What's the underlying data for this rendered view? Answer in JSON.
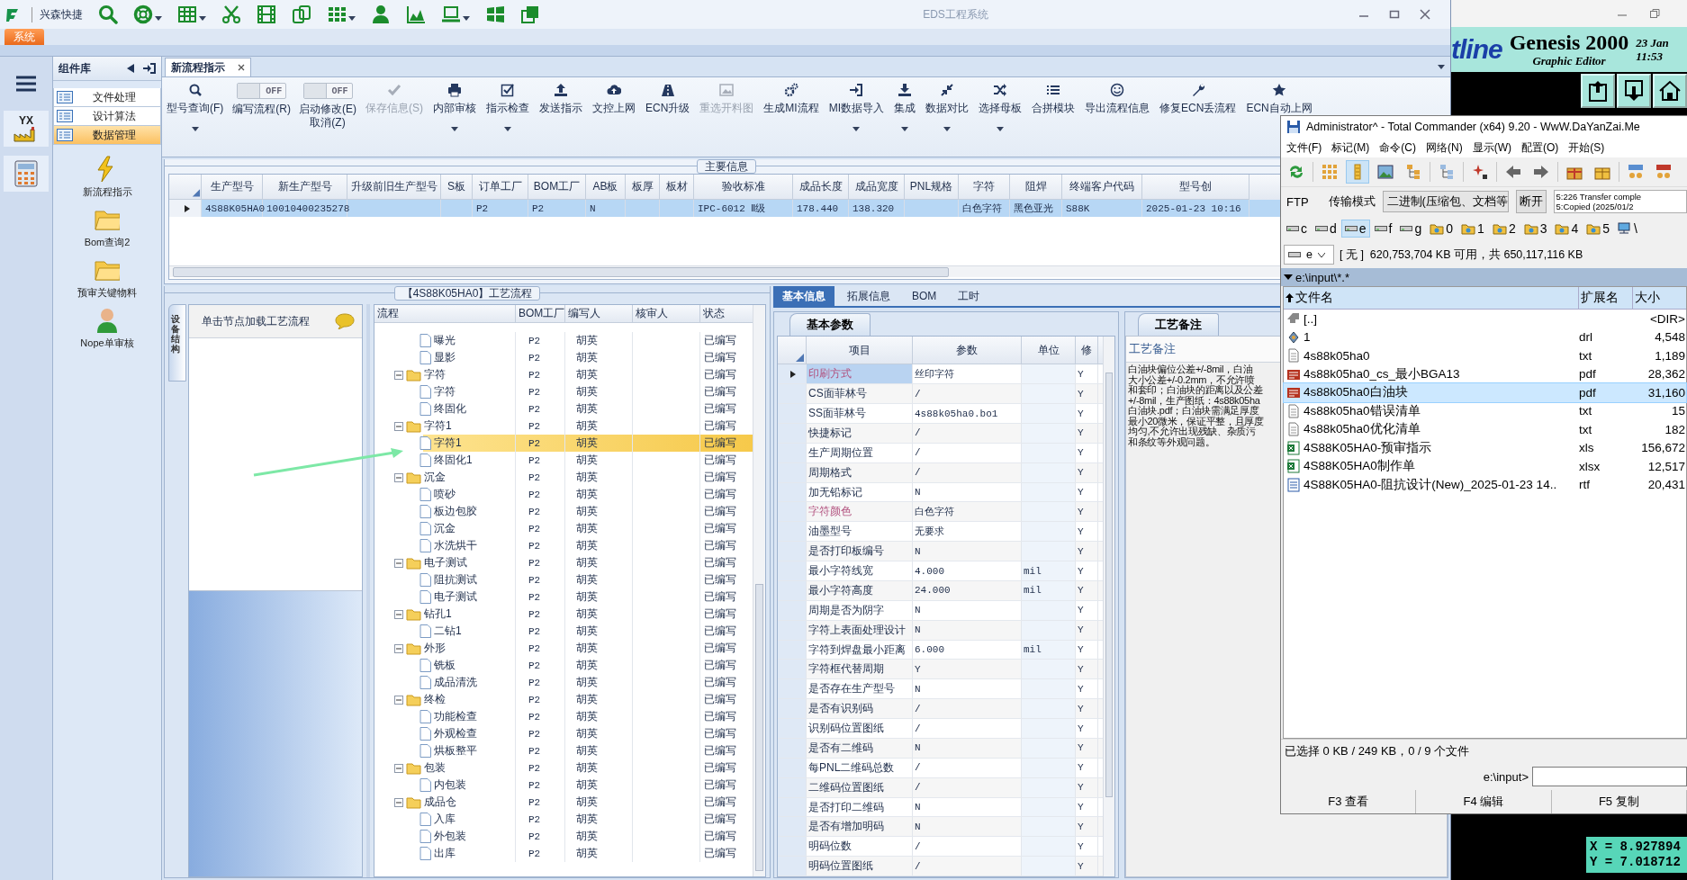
{
  "window": {
    "title": "EDS工程系统"
  },
  "quick_bar": {
    "app_name": "兴森快捷",
    "tools": [
      {
        "dropdown": false
      },
      {
        "dropdown": true
      },
      {
        "dropdown": true
      },
      {
        "dropdown": false
      },
      {
        "dropdown": false
      },
      {
        "dropdown": false
      },
      {
        "dropdown": true
      },
      {
        "dropdown": false
      },
      {
        "dropdown": false
      },
      {
        "dropdown": true
      },
      {
        "dropdown": false
      },
      {
        "dropdown": false
      }
    ]
  },
  "ribbon_tabs": [
    {
      "label": "系统",
      "selected": true
    }
  ],
  "left_rail": {
    "badge": "YX"
  },
  "component_library": {
    "title": "组件库",
    "sections": [
      {
        "label": "文件处理",
        "selected": false
      },
      {
        "label": "设计算法",
        "selected": false
      },
      {
        "label": "数据管理",
        "selected": true
      }
    ],
    "tools": [
      {
        "label": "新流程指示"
      },
      {
        "label": "Bom查询2"
      },
      {
        "label": "预审关键物料"
      },
      {
        "label": "Nope单审核"
      }
    ]
  },
  "document_tabs": [
    {
      "label": "新流程指示",
      "selected": true
    }
  ],
  "toolbar": [
    {
      "kind": "button",
      "label": "型号查询(F)",
      "dropdown": true,
      "disabled": false
    },
    {
      "kind": "toggle",
      "label": "编写流程(R)",
      "state_text": "OFF",
      "on": false
    },
    {
      "kind": "toggle",
      "label": "启动修改(E)\n取消(Z)",
      "state_text": "OFF",
      "on": false
    },
    {
      "kind": "button",
      "label": "保存信息(S)",
      "dropdown": false,
      "disabled": true
    },
    {
      "kind": "button",
      "label": "内部审核",
      "dropdown": true,
      "disabled": false
    },
    {
      "kind": "button",
      "label": "指示检查",
      "dropdown": true,
      "disabled": false
    },
    {
      "kind": "button",
      "label": "发送指示",
      "dropdown": false,
      "disabled": false
    },
    {
      "kind": "button",
      "label": "文控上网",
      "dropdown": false,
      "disabled": false
    },
    {
      "kind": "button",
      "label": "ECN升级",
      "dropdown": false,
      "disabled": false
    },
    {
      "kind": "button",
      "label": "重选开料图",
      "dropdown": false,
      "disabled": true
    },
    {
      "kind": "button",
      "label": "生成MI流程",
      "dropdown": false,
      "disabled": false
    },
    {
      "kind": "button",
      "label": "MI数据导入",
      "dropdown": true,
      "disabled": false
    },
    {
      "kind": "button",
      "label": "集成",
      "dropdown": true,
      "disabled": false
    },
    {
      "kind": "button",
      "label": "数据对比",
      "dropdown": true,
      "disabled": false
    },
    {
      "kind": "button",
      "label": "选择母板",
      "dropdown": true,
      "disabled": false
    },
    {
      "kind": "button",
      "label": "合拼模块",
      "dropdown": false,
      "disabled": false
    },
    {
      "kind": "button",
      "label": "导出流程信息",
      "dropdown": false,
      "disabled": false
    },
    {
      "kind": "button",
      "label": "修复ECN丢流程",
      "dropdown": false,
      "disabled": false
    },
    {
      "kind": "button",
      "label": "ECN自动上网",
      "dropdown": false,
      "disabled": false
    }
  ],
  "main_info": {
    "title": "主要信息",
    "columns": [
      "生产型号",
      "新生产型号",
      "升级前旧生产型号",
      "S板",
      "订单工厂",
      "BOM工厂",
      "AB板",
      "板厚",
      "板材",
      "验收标准",
      "成品长度",
      "成品宽度",
      "PNL规格",
      "字符",
      "阻焊",
      "终端客户代码",
      "型号创"
    ],
    "rows": [
      {
        "selected": true,
        "cells": [
          "4S88K05HA0",
          "10010400235278",
          null,
          null,
          "P2",
          "P2",
          "N",
          null,
          null,
          "IPC-6012 Ⅱ级",
          "178.440",
          "138.320",
          null,
          "白色字符",
          "黑色亚光",
          "S88K",
          "2025-01-23 10:16"
        ]
      }
    ]
  },
  "process_flow": {
    "title": "【4S88K05HA0】工艺流程",
    "side_tab": "设备结构",
    "hint": "单击节点加载工艺流程",
    "columns": [
      "流程",
      "BOM工厂",
      "编写人",
      "核审人",
      "状态"
    ],
    "tree": [
      {
        "children": [
          {
            "name": "曝光",
            "bom": "P2",
            "writer": "胡英",
            "status": "已编写",
            "selected": false
          },
          {
            "name": "显影",
            "bom": "P2",
            "writer": "胡英",
            "status": "已编写",
            "selected": false
          }
        ]
      },
      {
        "name": "字符",
        "bom": "P2",
        "writer": "胡英",
        "status": "已编写",
        "selected": false,
        "expanded": true,
        "children": [
          {
            "name": "字符",
            "bom": "P2",
            "writer": "胡英",
            "status": "已编写",
            "selected": false
          },
          {
            "name": "终固化",
            "bom": "P2",
            "writer": "胡英",
            "status": "已编写",
            "selected": false
          }
        ]
      },
      {
        "name": "字符1",
        "bom": "P2",
        "writer": "胡英",
        "status": "已编写",
        "selected": false,
        "expanded": true,
        "children": [
          {
            "name": "字符1",
            "bom": "P2",
            "writer": "胡英",
            "status": "已编写",
            "selected": true
          },
          {
            "name": "终固化1",
            "bom": "P2",
            "writer": "胡英",
            "status": "已编写",
            "selected": false
          }
        ]
      },
      {
        "name": "沉金",
        "bom": "P2",
        "writer": "胡英",
        "status": "已编写",
        "selected": false,
        "expanded": true,
        "children": [
          {
            "name": "喷砂",
            "bom": "P2",
            "writer": "胡英",
            "status": "已编写",
            "selected": false
          },
          {
            "name": "板边包胶",
            "bom": "P2",
            "writer": "胡英",
            "status": "已编写",
            "selected": false
          },
          {
            "name": "沉金",
            "bom": "P2",
            "writer": "胡英",
            "status": "已编写",
            "selected": false
          },
          {
            "name": "水洗烘干",
            "bom": "P2",
            "writer": "胡英",
            "status": "已编写",
            "selected": false
          }
        ]
      },
      {
        "name": "电子测试",
        "bom": "P2",
        "writer": "胡英",
        "status": "已编写",
        "selected": false,
        "expanded": true,
        "children": [
          {
            "name": "阻抗测试",
            "bom": "P2",
            "writer": "胡英",
            "status": "已编写",
            "selected": false
          },
          {
            "name": "电子测试",
            "bom": "P2",
            "writer": "胡英",
            "status": "已编写",
            "selected": false
          }
        ]
      },
      {
        "name": "钻孔1",
        "bom": "P2",
        "writer": "胡英",
        "status": "已编写",
        "selected": false,
        "expanded": true,
        "children": [
          {
            "name": "二钻1",
            "bom": "P2",
            "writer": "胡英",
            "status": "已编写",
            "selected": false
          }
        ]
      },
      {
        "name": "外形",
        "bom": "P2",
        "writer": "胡英",
        "status": "已编写",
        "selected": false,
        "expanded": true,
        "children": [
          {
            "name": "铣板",
            "bom": "P2",
            "writer": "胡英",
            "status": "已编写",
            "selected": false
          },
          {
            "name": "成品清洗",
            "bom": "P2",
            "writer": "胡英",
            "status": "已编写",
            "selected": false
          }
        ]
      },
      {
        "name": "终检",
        "bom": "P2",
        "writer": "胡英",
        "status": "已编写",
        "selected": false,
        "expanded": true,
        "children": [
          {
            "name": "功能检查",
            "bom": "P2",
            "writer": "胡英",
            "status": "已编写",
            "selected": false
          },
          {
            "name": "外观检查",
            "bom": "P2",
            "writer": "胡英",
            "status": "已编写",
            "selected": false
          },
          {
            "name": "烘板整平",
            "bom": "P2",
            "writer": "胡英",
            "status": "已编写",
            "selected": false
          }
        ]
      },
      {
        "name": "包装",
        "bom": "P2",
        "writer": "胡英",
        "status": "已编写",
        "selected": false,
        "expanded": true,
        "children": [
          {
            "name": "内包装",
            "bom": "P2",
            "writer": "胡英",
            "status": "已编写",
            "selected": false
          }
        ]
      },
      {
        "name": "成品仓",
        "bom": "P2",
        "writer": "胡英",
        "status": "已编写",
        "selected": false,
        "expanded": true,
        "children": [
          {
            "name": "入库",
            "bom": "P2",
            "writer": "胡英",
            "status": "已编写",
            "selected": false
          },
          {
            "name": "外包装",
            "bom": "P2",
            "writer": "胡英",
            "status": "已编写",
            "selected": false
          },
          {
            "name": "出库",
            "bom": "P2",
            "writer": "胡英",
            "status": "已编写",
            "selected": false
          }
        ]
      }
    ]
  },
  "detail_tabs": [
    {
      "label": "基本信息",
      "selected": true
    },
    {
      "label": "拓展信息",
      "selected": false
    },
    {
      "label": "BOM",
      "selected": false
    },
    {
      "label": "工时",
      "selected": false
    }
  ],
  "basic_params": {
    "tab": "基本参数",
    "columns": [
      "项目",
      "参数",
      "单位",
      "修"
    ],
    "rows": [
      {
        "item": "印刷方式",
        "value": "丝印字符",
        "flag": "Y",
        "selected": true,
        "highlighted": true
      },
      {
        "item": "CS面菲林号",
        "value": "/",
        "flag": "Y",
        "selected": false,
        "highlighted": false
      },
      {
        "item": "SS面菲林号",
        "value": "4s88k05ha0.bo1",
        "flag": "Y",
        "selected": false,
        "highlighted": false
      },
      {
        "item": "快捷标记",
        "value": "/",
        "flag": "Y",
        "selected": false,
        "highlighted": false
      },
      {
        "item": "生产周期位置",
        "value": "/",
        "flag": "Y",
        "selected": false,
        "highlighted": false
      },
      {
        "item": "周期格式",
        "value": "/",
        "flag": "Y",
        "selected": false,
        "highlighted": false
      },
      {
        "item": "加无铅标记",
        "value": "N",
        "flag": "Y",
        "selected": false,
        "highlighted": false
      },
      {
        "item": "字符颜色",
        "value": "白色字符",
        "flag": "Y",
        "selected": false,
        "highlighted": true
      },
      {
        "item": "油墨型号",
        "value": "无要求",
        "flag": "Y",
        "selected": false,
        "highlighted": false
      },
      {
        "item": "是否打印板编号",
        "value": "N",
        "flag": "Y",
        "selected": false,
        "highlighted": false
      },
      {
        "item": "最小字符线宽",
        "value": "4.000",
        "unit": "mil",
        "flag": "Y",
        "selected": false,
        "highlighted": false
      },
      {
        "item": "最小字符高度",
        "value": "24.000",
        "unit": "mil",
        "flag": "Y",
        "selected": false,
        "highlighted": false
      },
      {
        "item": "周期是否为阴字",
        "value": "N",
        "flag": "Y",
        "selected": false,
        "highlighted": false
      },
      {
        "item": "字符上表面处理设计",
        "value": "N",
        "flag": "Y",
        "selected": false,
        "highlighted": false
      },
      {
        "item": "字符到焊盘最小距离",
        "value": "6.000",
        "unit": "mil",
        "flag": "Y",
        "selected": false,
        "highlighted": false
      },
      {
        "item": "字符框代替周期",
        "value": "Y",
        "flag": "Y",
        "selected": false,
        "highlighted": false
      },
      {
        "item": "是否存在生产型号",
        "value": "N",
        "flag": "Y",
        "selected": false,
        "highlighted": false
      },
      {
        "item": "是否有识别码",
        "value": "/",
        "flag": "Y",
        "selected": false,
        "highlighted": false
      },
      {
        "item": "识别码位置图纸",
        "value": "/",
        "flag": "Y",
        "selected": false,
        "highlighted": false
      },
      {
        "item": "是否有二维码",
        "value": "N",
        "flag": "Y",
        "selected": false,
        "highlighted": false
      },
      {
        "item": "每PNL二维码总数",
        "value": "/",
        "flag": "Y",
        "selected": false,
        "highlighted": false
      },
      {
        "item": "二维码位置图纸",
        "value": "/",
        "flag": "Y",
        "selected": false,
        "highlighted": false
      },
      {
        "item": "是否打印二维码",
        "value": "N",
        "flag": "Y",
        "selected": false,
        "highlighted": false
      },
      {
        "item": "是否有增加明码",
        "value": "N",
        "flag": "Y",
        "selected": false,
        "highlighted": false
      },
      {
        "item": "明码位数",
        "value": "/",
        "flag": "Y",
        "selected": false,
        "highlighted": false
      },
      {
        "item": "明码位置图纸",
        "value": "/",
        "flag": "Y",
        "selected": false,
        "highlighted": false
      }
    ]
  },
  "process_notes": {
    "tab": "工艺备注",
    "header": "工艺备注",
    "lines": [
      "白油块偏位公差+/-8mil，白油",
      "大小公差+/-0.2mm，不允许喷",
      "和套印；白油块的距离以及公差",
      "+/-8mil，生产图纸：4s88k05ha",
      "白油块.pdf；白油块需满足厚度",
      "最小20微米，保证平整，且厚度",
      "均匀,不允许出现残缺、杂质污",
      "和条纹等外观问题。"
    ]
  },
  "genesis": {
    "logo": "tline",
    "title": "Genesis 2000",
    "subtitle": "Graphic Editor",
    "date": "23 Jan",
    "time": "11:53",
    "coords": [
      "X = 8.927894",
      "Y = 7.018712"
    ]
  },
  "total_commander": {
    "title": "Administrator^ - Total Commander (x64) 9.20 - WwW.DaYanZai.Me",
    "menu": [
      "文件(F)",
      "标记(M)",
      "命令(C)",
      "网络(N)",
      "显示(W)",
      "配置(O)",
      "开始(S)"
    ],
    "toolbar": [
      {
        "pressed": false
      },
      {
        "pressed": false
      },
      {
        "pressed": true
      },
      {
        "pressed": false
      },
      {
        "pressed": false
      },
      {
        "pressed": false
      },
      {
        "pressed": false
      },
      {
        "pressed": false
      },
      {
        "pressed": false
      },
      {
        "pressed": false
      },
      {
        "pressed": false
      },
      {
        "pressed": false
      },
      {
        "pressed": false
      }
    ],
    "ftp": {
      "label": "FTP",
      "mode_label": "传输模式",
      "mode_value": "二进制(压缩包、文档等",
      "disconnect": "断开",
      "log": [
        "5:226 Transfer comple",
        "5:Copied (2025/01/2"
      ]
    },
    "drives": [
      {
        "label": "c",
        "kind": "disk",
        "selected": false
      },
      {
        "label": "d",
        "kind": "disk",
        "selected": false
      },
      {
        "label": "e",
        "kind": "disk",
        "selected": true
      },
      {
        "label": "f",
        "kind": "disk",
        "selected": false
      },
      {
        "label": "g",
        "kind": "disk",
        "selected": false
      },
      {
        "label": "0",
        "kind": "folder",
        "selected": false
      },
      {
        "label": "1",
        "kind": "folder",
        "selected": false
      },
      {
        "label": "2",
        "kind": "folder",
        "selected": false
      },
      {
        "label": "3",
        "kind": "folder",
        "selected": false
      },
      {
        "label": "4",
        "kind": "folder",
        "selected": false
      },
      {
        "label": "5",
        "kind": "folder",
        "selected": false
      },
      {
        "label": "\\",
        "kind": "network",
        "selected": false
      }
    ],
    "drive_combo": "e",
    "free_space": "[ 无 ]  620,753,704 KB 可用，共 650,117,116 KB",
    "path": "e:\\input\\*.*",
    "columns": [
      "文件名",
      "扩展名",
      "大小"
    ],
    "files": [
      {
        "name": "[..]",
        "size": "<DIR>",
        "kind": "up",
        "selected": false
      },
      {
        "name": "1",
        "ext": "drl",
        "size": "4,548",
        "kind": "drill",
        "selected": false
      },
      {
        "name": "4s88k05ha0",
        "ext": "txt",
        "size": "1,189",
        "kind": "text",
        "selected": false
      },
      {
        "name": "4s88k05ha0_cs_最小BGA13",
        "ext": "pdf",
        "size": "28,362",
        "kind": "pdf",
        "selected": false
      },
      {
        "name": "4s88k05ha0白油块",
        "ext": "pdf",
        "size": "31,160",
        "kind": "pdf",
        "selected": true
      },
      {
        "name": "4s88k05ha0错误清单",
        "ext": "txt",
        "size": "15",
        "kind": "text",
        "selected": false
      },
      {
        "name": "4s88k05ha0优化清单",
        "ext": "txt",
        "size": "182",
        "kind": "text",
        "selected": false
      },
      {
        "name": "4S88K05HA0-预审指示",
        "ext": "xls",
        "size": "156,672",
        "kind": "sheet",
        "selected": false
      },
      {
        "name": "4S88K05HA0制作单",
        "ext": "xlsx",
        "size": "12,517",
        "kind": "sheet",
        "selected": false
      },
      {
        "name": "4S88K05HA0-阻抗设计(New)_2025-01-23 14..",
        "ext": "rtf",
        "size": "20,431",
        "kind": "doc",
        "selected": false
      }
    ],
    "status": "已选择 0 KB / 249 KB，0 / 9 个文件",
    "prompt": "e:\\input>",
    "function_keys": [
      "F3 查看",
      "F4 编辑",
      "F5 复制"
    ]
  }
}
